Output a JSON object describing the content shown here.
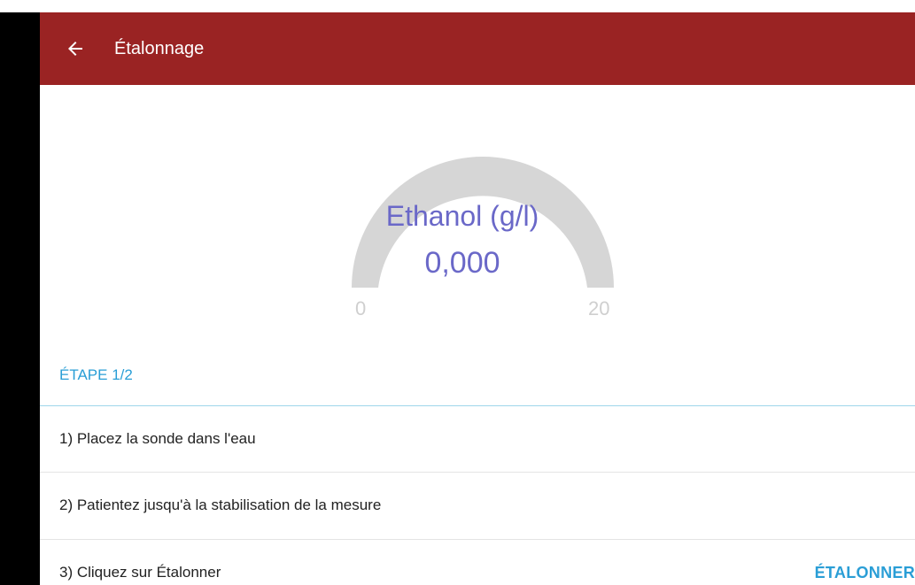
{
  "colors": {
    "toolbar_bg": "#9a2323",
    "accent": "#2a9ed6",
    "gauge_text": "#6a68c8",
    "gauge_track": "#d6d6d6",
    "divider_accent": "#9ed6ea"
  },
  "toolbar": {
    "back_icon": "arrow-left-icon",
    "title": "Étalonnage"
  },
  "gauge": {
    "label": "Ethanol (g/l)",
    "value": "0,000",
    "min_label": "0",
    "max_label": "20",
    "level_fraction": 0
  },
  "step": {
    "header": "ÉTAPE 1/2"
  },
  "instructions": [
    {
      "text": "1) Placez la sonde dans l'eau"
    },
    {
      "text": "2) Patientez jusqu'à la stabilisation de la mesure"
    },
    {
      "text": "3) Cliquez sur Étalonner",
      "action_label": "ÉTALONNER"
    }
  ]
}
